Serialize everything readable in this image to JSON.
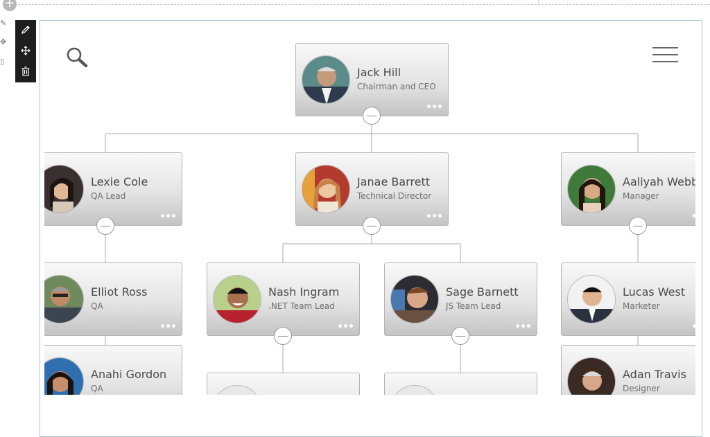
{
  "toolbar": {
    "add_label": "+",
    "edit_icon": "pencil-icon",
    "move_icon": "move-arrows-icon",
    "delete_icon": "trash-icon"
  },
  "chart_controls": {
    "search_icon": "magnifier-icon",
    "menu_icon": "hamburger-menu-icon"
  },
  "org_chart": {
    "more_label": "•••",
    "people": [
      {
        "name": "Jack Hill",
        "title": "Chairman and CEO"
      },
      {
        "name": "Lexie Cole",
        "title": "QA Lead"
      },
      {
        "name": "Janae Barrett",
        "title": "Technical Director"
      },
      {
        "name": "Aaliyah Webb",
        "title": "Manager"
      },
      {
        "name": "Elliot Ross",
        "title": "QA"
      },
      {
        "name": "Nash Ingram",
        "title": ".NET Team Lead"
      },
      {
        "name": "Sage Barnett",
        "title": "JS Team Lead"
      },
      {
        "name": "Lucas West",
        "title": "Marketer"
      },
      {
        "name": "Anahi Gordon",
        "title": "QA"
      },
      {
        "name": "",
        "title": ""
      },
      {
        "name": "",
        "title": ""
      },
      {
        "name": "Adan Travis",
        "title": "Designer"
      }
    ]
  },
  "colors": {
    "toolbar_bg": "#1e1e1e",
    "card_gradient_top": "#f8f8f8",
    "card_gradient_bottom": "#c4c4c4",
    "connector": "#a8a8a8",
    "frame_border": "#a8c7d8"
  }
}
